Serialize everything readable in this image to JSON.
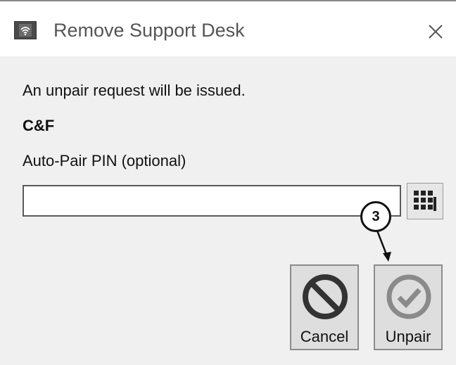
{
  "window": {
    "title": "Remove Support Desk",
    "app_icon": "wifi-icon",
    "close_icon": "close-icon"
  },
  "content": {
    "message": "An unpair request will be issued.",
    "device_name": "C&F",
    "pin_label": "Auto-Pair PIN (optional)",
    "pin_value": "",
    "keypad_icon": "keypad-icon"
  },
  "buttons": {
    "cancel_label": "Cancel",
    "cancel_icon": "prohibited-icon",
    "unpair_label": "Unpair",
    "unpair_icon": "checkmark-circle-icon"
  },
  "annotation": {
    "callout_number": "3"
  }
}
